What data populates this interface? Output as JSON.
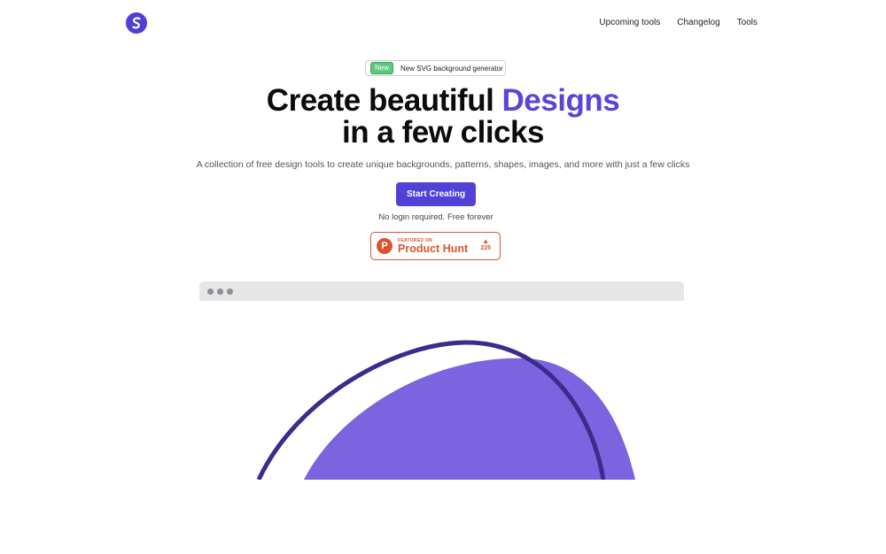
{
  "header": {
    "nav": [
      "Upcoming tools",
      "Changelog",
      "Tools"
    ]
  },
  "announcement": {
    "tag": "New",
    "text": "New SVG background generator"
  },
  "hero": {
    "headline_part1": "Create beautiful ",
    "headline_accent": "Designs",
    "headline_line2": "in a few clicks",
    "subtitle": "A collection of free design tools to create unique backgrounds, patterns, shapes, images, and more with just a few clicks",
    "cta_label": "Start Creating",
    "note": "No login required. Free forever"
  },
  "product_hunt": {
    "logo_letter": "P",
    "featured": "FEATURED ON",
    "name": "Product Hunt",
    "arrow": "▲",
    "votes": "225"
  },
  "colors": {
    "accent": "#5a45d6",
    "button": "#5141d9",
    "shape_fill": "#7c63e0",
    "shape_stroke": "#3d2a8e",
    "product_hunt": "#da552f",
    "badge_new": "#5cc77d"
  }
}
